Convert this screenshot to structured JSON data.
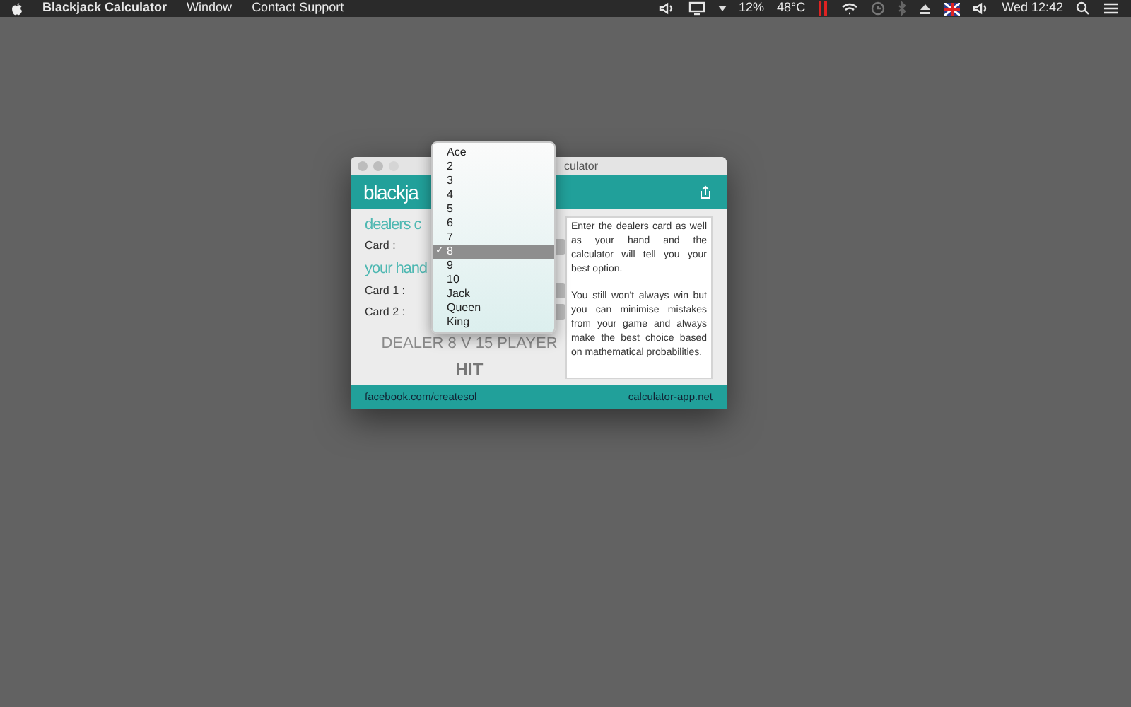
{
  "menu_bar": {
    "app_name": "Blackjack Calculator",
    "menus": [
      "Window",
      "Contact Support"
    ],
    "status": {
      "battery": "12%",
      "temperature": "48°C",
      "clock": "Wed 12:42"
    }
  },
  "window": {
    "title": "culator",
    "logo": "blackja",
    "dealer_section": {
      "heading": "dealers c",
      "card_label": "Card :"
    },
    "hand_section": {
      "heading": "your hand",
      "card_labels": [
        "Card 1 :",
        "Card 2 :"
      ]
    },
    "summary": "DEALER 8 V 15 PLAYER",
    "advice": "HIT",
    "info": [
      "Enter the dealers card as well as your hand and the calculator will tell you your best option.",
      "You still won't always win but you can minimise mistakes from your game and always make the best choice based on mathematical probabilities."
    ],
    "footer": {
      "left_link": "facebook.com/createsol",
      "right_link": "calculator-app.net"
    }
  },
  "card_menu": [
    {
      "label": "Ace",
      "selected": false
    },
    {
      "label": "2",
      "selected": false
    },
    {
      "label": "3",
      "selected": false
    },
    {
      "label": "4",
      "selected": false
    },
    {
      "label": "5",
      "selected": false
    },
    {
      "label": "6",
      "selected": false
    },
    {
      "label": "7",
      "selected": false
    },
    {
      "label": "8",
      "selected": true
    },
    {
      "label": "9",
      "selected": false
    },
    {
      "label": "10",
      "selected": false
    },
    {
      "label": "Jack",
      "selected": false
    },
    {
      "label": "Queen",
      "selected": false
    },
    {
      "label": "King",
      "selected": false
    }
  ],
  "check_mark": "✓"
}
